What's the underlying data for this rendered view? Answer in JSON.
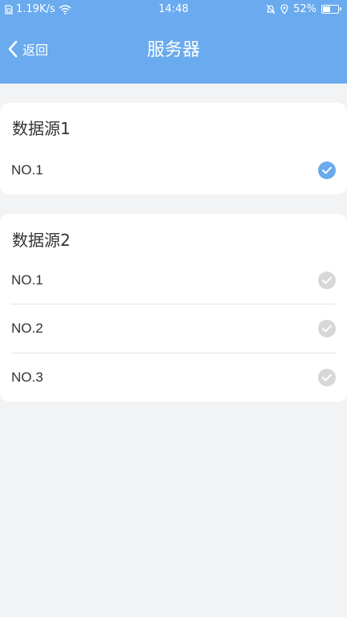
{
  "status_bar": {
    "network_speed": "1.19K/s",
    "time": "14:48",
    "battery_percent": "52%",
    "battery_level": 0.52
  },
  "nav": {
    "back_label": "返回",
    "title": "服务器"
  },
  "groups": [
    {
      "title": "数据源1",
      "items": [
        {
          "label": "NO.1",
          "selected": true
        }
      ]
    },
    {
      "title": "数据源2",
      "items": [
        {
          "label": "NO.1",
          "selected": false
        },
        {
          "label": "NO.2",
          "selected": false
        },
        {
          "label": "NO.3",
          "selected": false
        }
      ]
    }
  ],
  "colors": {
    "accent": "#6aaaee",
    "background": "#f2f3f5",
    "unchecked": "#d7d7d7"
  },
  "icons": {
    "sim": "sim-card-icon",
    "wifi": "wifi-icon",
    "mute": "bell-mute-icon",
    "location": "location-pin-icon",
    "battery": "battery-icon",
    "back": "chevron-left-icon",
    "check": "check-circle-icon"
  }
}
